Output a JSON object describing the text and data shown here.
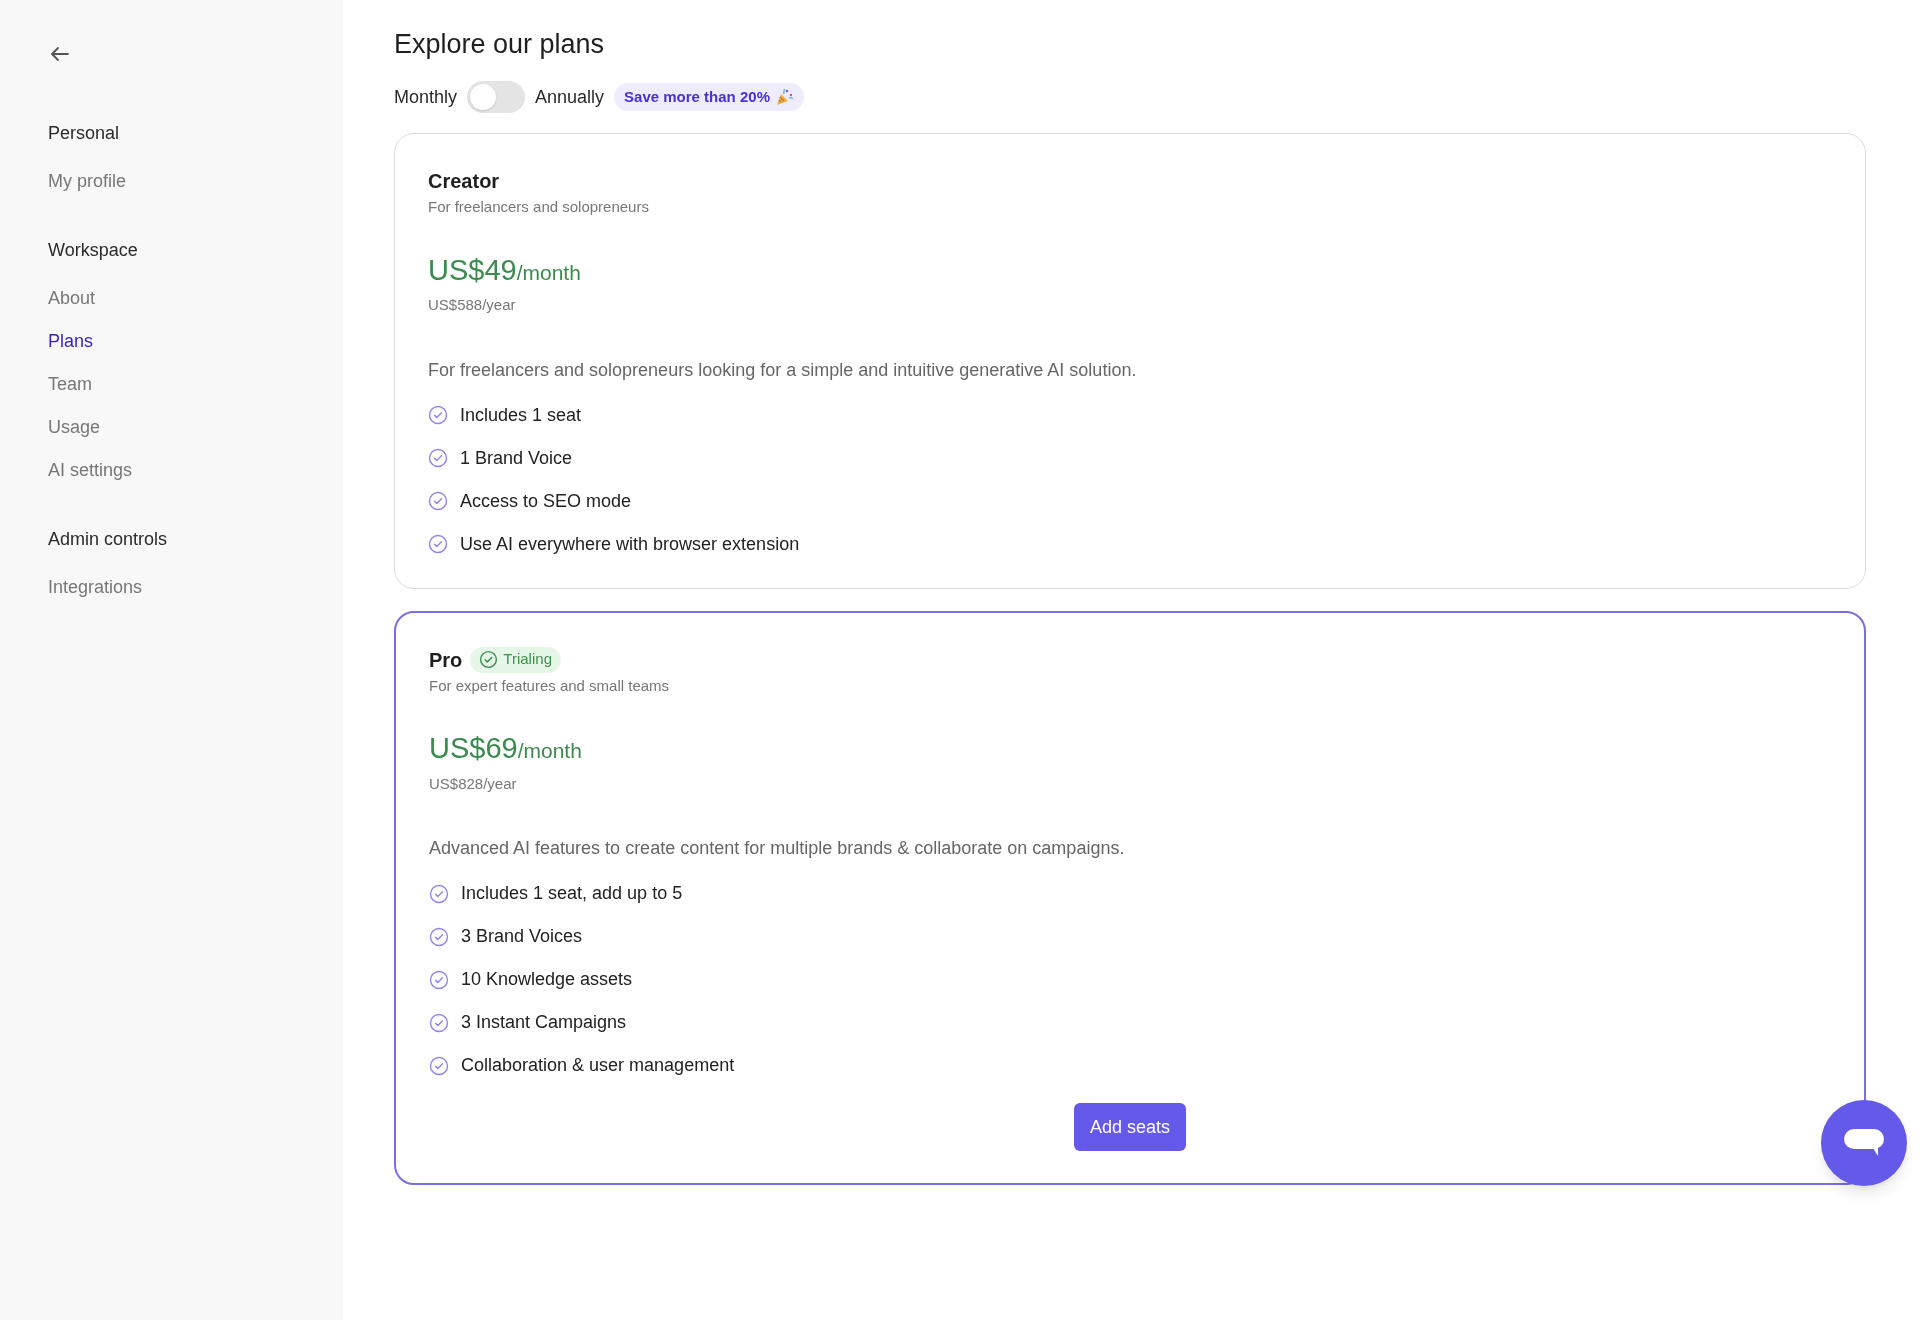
{
  "sidebar": {
    "sections": [
      {
        "heading": "Personal",
        "items": [
          {
            "label": "My profile",
            "selected": false
          }
        ]
      },
      {
        "heading": "Workspace",
        "items": [
          {
            "label": "About",
            "selected": false
          },
          {
            "label": "Plans",
            "selected": true
          },
          {
            "label": "Team",
            "selected": false
          },
          {
            "label": "Usage",
            "selected": false
          },
          {
            "label": "AI settings",
            "selected": false
          }
        ]
      },
      {
        "heading": "Admin controls",
        "items": [
          {
            "label": "Integrations",
            "selected": false
          }
        ]
      }
    ]
  },
  "title": "Explore our plans",
  "billing": {
    "monthly_label": "Monthly",
    "annual_label": "Annually",
    "annual_on": false,
    "promo": "Save more than 20%"
  },
  "plans": [
    {
      "name": "Creator",
      "subtitle": "For freelancers and solopreneurs",
      "price": "US$49",
      "period": "/month",
      "yearly": "US$588/year",
      "highlighted": false,
      "description": "For freelancers and solopreneurs looking for a simple and intuitive generative AI solution.",
      "features": [
        "Includes 1 seat",
        "1 Brand Voice",
        "Access to SEO mode",
        "Use AI everywhere with browser extension"
      ]
    },
    {
      "name": "Pro",
      "badge": "Trialing",
      "subtitle": "For expert features and small teams",
      "price": "US$69",
      "period": "/month",
      "yearly": "US$828/year",
      "highlighted": true,
      "description": "Advanced AI features to create content for multiple brands & collaborate on campaigns.",
      "features": [
        "Includes 1 seat, add up to 5",
        "3 Brand Voices",
        "10 Knowledge assets",
        "3 Instant Campaigns",
        "Collaboration & user management"
      ],
      "button": "Add seats"
    }
  ]
}
